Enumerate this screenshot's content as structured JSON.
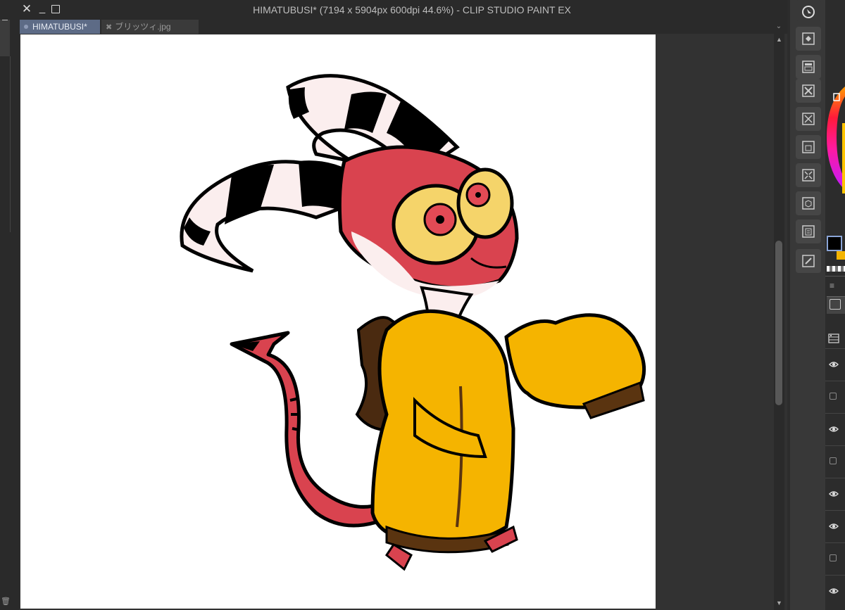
{
  "window": {
    "title": "HIMATUBUSI* (7194 x 5904px 600dpi 44.6%)  - CLIP STUDIO PAINT EX",
    "close_glyph": "✕",
    "minimize_glyph": "_"
  },
  "tabs": [
    {
      "label": "HIMATUBUSI*",
      "active": true
    },
    {
      "label": "ブリッツィ.jpg",
      "active": false
    }
  ],
  "tabbar": {
    "chevron": "⌄"
  },
  "scrollbar": {
    "up": "▲",
    "down": "▼"
  },
  "dock_icons": [
    "navigator-icon",
    "layer-property-icon",
    "sub-view-icon",
    "close-panel-icon",
    "material-icon",
    "auto-action-icon",
    "tool-property-icon",
    "3d-object-icon",
    "layer-search-icon",
    "history-icon"
  ],
  "colors": {
    "main": "#000000",
    "sub": "#f4b400",
    "accent_tab": "#5d6b86",
    "canvas": "#ffffff"
  },
  "layers": {
    "menu_glyph": "≡",
    "rows": [
      {
        "visible": true
      },
      {
        "visible": false
      },
      {
        "visible": true
      },
      {
        "visible": false
      },
      {
        "visible": true
      },
      {
        "visible": true
      },
      {
        "visible": false
      },
      {
        "visible": true
      }
    ]
  },
  "left_panel": {
    "trash_glyph": "🗑"
  }
}
